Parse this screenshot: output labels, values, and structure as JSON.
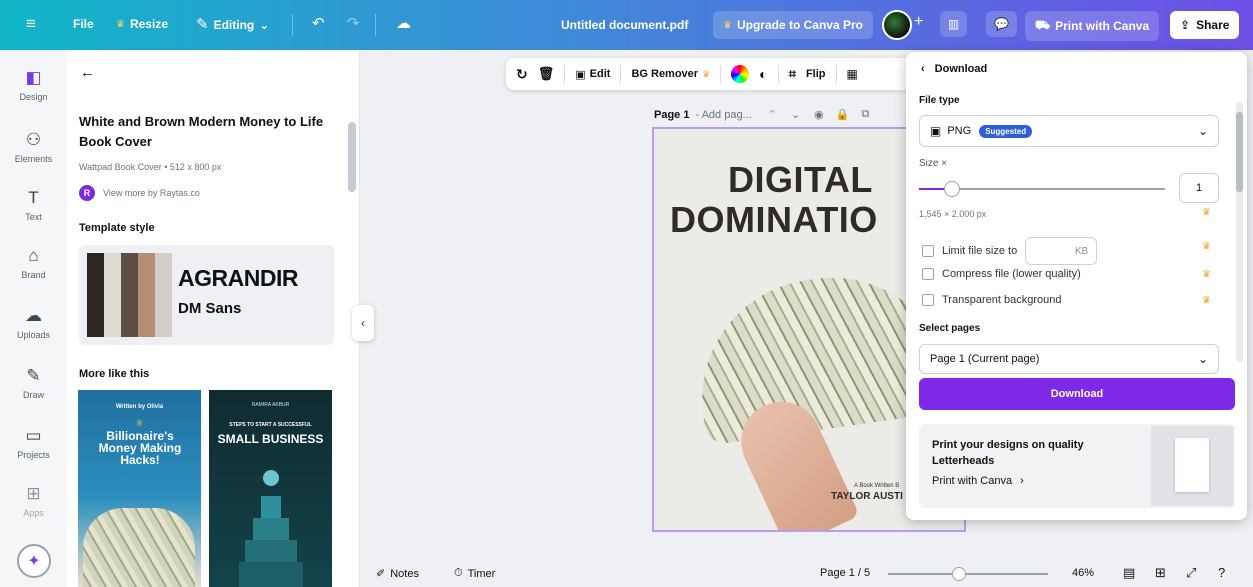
{
  "topbar": {
    "file": "File",
    "resize": "Resize",
    "editing": "Editing",
    "doc_title": "Untitled document.pdf",
    "upgrade": "Upgrade to Canva Pro",
    "print": "Print with Canva",
    "share": "Share"
  },
  "rail": {
    "items": [
      {
        "label": "Design",
        "icon": "design-icon"
      },
      {
        "label": "Elements",
        "icon": "elements-icon"
      },
      {
        "label": "Text",
        "icon": "text-icon"
      },
      {
        "label": "Brand",
        "icon": "brand-icon"
      },
      {
        "label": "Uploads",
        "icon": "uploads-icon"
      },
      {
        "label": "Draw",
        "icon": "draw-icon"
      },
      {
        "label": "Projects",
        "icon": "projects-icon"
      },
      {
        "label": "Apps",
        "icon": "apps-icon"
      }
    ]
  },
  "panel": {
    "title": "White and Brown Modern Money to Life Book Cover",
    "subtitle": "Wattpad Book Cover • 512 x 800 px",
    "author_initial": "R",
    "author": "View more by Raytas.co",
    "template_style_heading": "Template style",
    "font_primary": "AGRANDIR",
    "font_secondary": "DM Sans",
    "swatches": [
      "#2c2724",
      "#e0dcd3",
      "#5c4e43",
      "#b48f75",
      "#ffffff"
    ],
    "more_like_this": "More like this",
    "card1": {
      "top": "Written by Olivia",
      "title": "Billionaire's Money Making Hacks!"
    },
    "card2": {
      "top": "RAMIRA AKBUR",
      "kicker": "STEPS TO START A SUCCESSFUL",
      "title": "SMALL BUSINESS"
    }
  },
  "toolbar": {
    "edit": "Edit",
    "bg_remover": "BG Remover",
    "flip": "Flip"
  },
  "canvas": {
    "page_label": "Page 1",
    "page_title_placeholder": "- Add pag...",
    "headline1": "DIGITAL",
    "headline2": "DOMINATIO",
    "byline": "A Book Written B",
    "author": "TAYLOR AUSTI"
  },
  "download": {
    "back_title": "Download",
    "file_type_label": "File type",
    "file_type_value": "PNG",
    "suggested_badge": "Suggested",
    "size_label": "Size ×",
    "size_value": "1",
    "size_fraction": 0.1,
    "dimensions": "1,545 × 2,000 px",
    "limit_file_size": "Limit file size to",
    "kb_unit": "KB",
    "compress": "Compress file (lower quality)",
    "transparent": "Transparent background",
    "select_pages_label": "Select pages",
    "pages_value": "Page 1 (Current page)",
    "download_button": "Download",
    "promo_title": "Print your designs on quality Letterheads",
    "promo_link": "Print with Canva"
  },
  "bottom": {
    "notes": "Notes",
    "timer": "Timer",
    "page_indicator": "Page 1 / 5",
    "zoom": "46%",
    "zoom_fraction": 0.4
  },
  "colors": {
    "accent": "#7d2ae8",
    "crown": "#f1a62b"
  }
}
